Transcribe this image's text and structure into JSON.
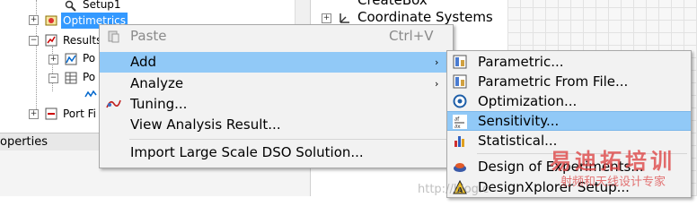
{
  "tree": {
    "items": [
      {
        "label": "Setup1"
      },
      {
        "label": "Optimetrics"
      },
      {
        "label": "Results"
      },
      {
        "label": "Po"
      },
      {
        "label": "Po"
      },
      {
        "label": "Port Fi"
      }
    ],
    "properties_label": "operties"
  },
  "middle": {
    "create_box": "CreateBox",
    "coordinate_systems": "Coordinate Systems"
  },
  "menu": {
    "items": [
      {
        "label": "Paste",
        "shortcut": "Ctrl+V"
      },
      {
        "label": "Add",
        "arrow": "›"
      },
      {
        "label": "Analyze",
        "arrow": "›"
      },
      {
        "label": "Tuning..."
      },
      {
        "label": "View Analysis Result..."
      },
      {
        "label": "Import Large Scale DSO Solution..."
      }
    ]
  },
  "submenu": {
    "items": [
      {
        "label": "Parametric...",
        "icon": "parametric-icon"
      },
      {
        "label": "Parametric From File...",
        "icon": "parametric-file-icon"
      },
      {
        "label": "Optimization...",
        "icon": "optimization-icon"
      },
      {
        "label": "Sensitivity...",
        "icon": "sensitivity-icon"
      },
      {
        "label": "Statistical...",
        "icon": "statistical-icon"
      },
      {
        "label": "Design of Experiments...",
        "icon": "doe-icon"
      },
      {
        "label": "DesignXplorer Setup...",
        "icon": "designxplorer-icon"
      }
    ]
  },
  "watermark": {
    "title": "易迪拓培训",
    "subtitle": "射频和天线设计专家",
    "url": "http://blog.c"
  },
  "colors": {
    "highlight": "#91c9f7",
    "menu_bg": "#f2f2f2",
    "selection": "#3399ff"
  }
}
